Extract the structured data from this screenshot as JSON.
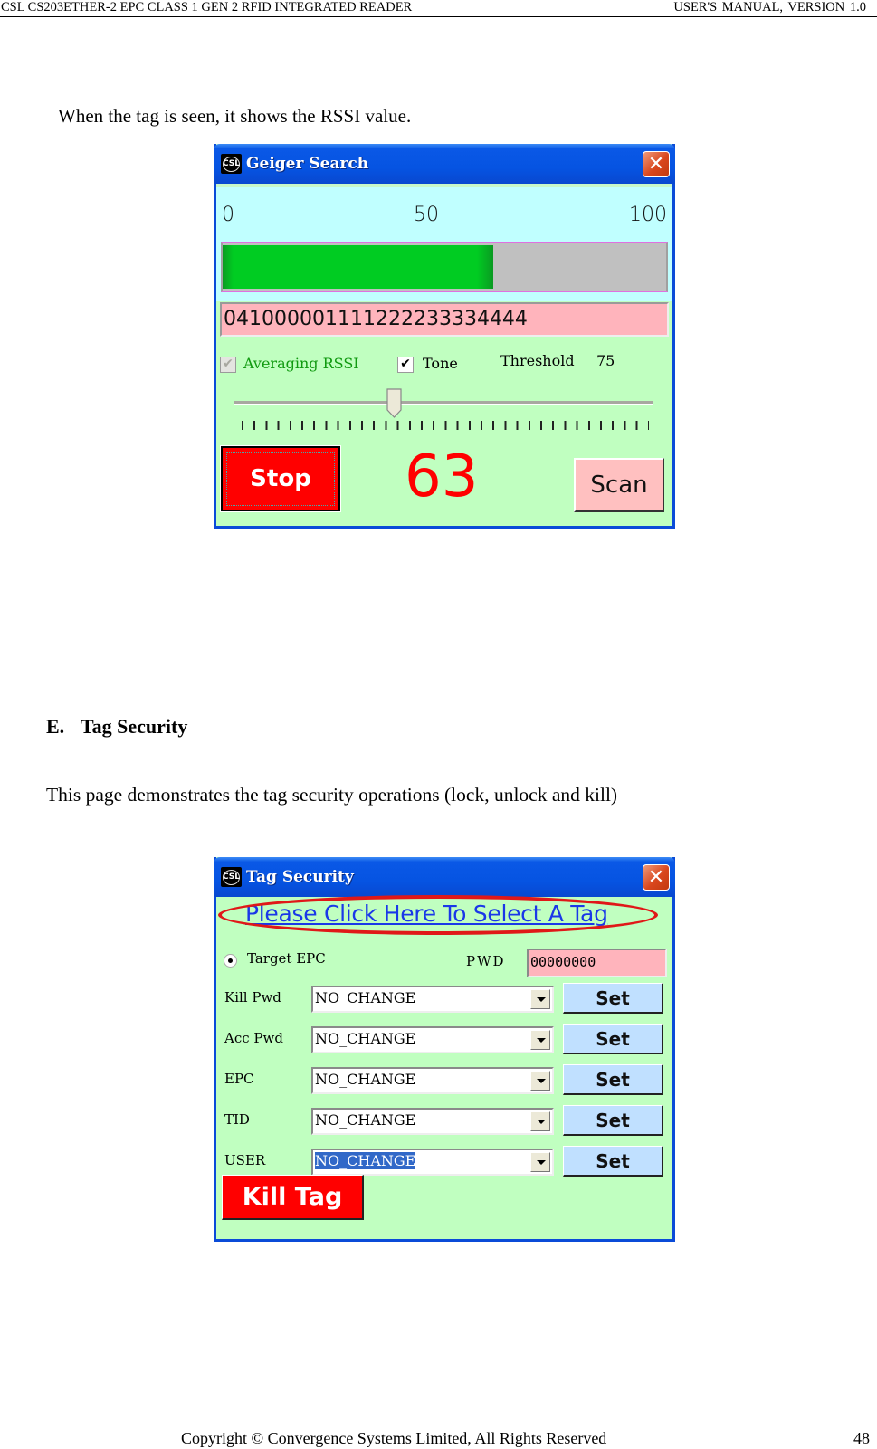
{
  "header": {
    "left": "CSL CS203ETHER-2 EPC CLASS 1 GEN 2 RFID INTEGRATED READER",
    "right": "USER'S  MANUAL,  VERSION  1.0"
  },
  "intro_text": "When the tag is seen, it shows the RSSI value.",
  "geiger_window": {
    "icon_label": "CSL",
    "title": "Geiger Search",
    "close_label": "✕",
    "scale": [
      "0",
      "50",
      "100"
    ],
    "signal_level_percent": 61,
    "epc": "041000001111222233334444",
    "averaging_rssi_label": "Averaging RSSI",
    "averaging_rssi_checked": true,
    "averaging_rssi_enabled": false,
    "tone_label": "Tone",
    "tone_checked": true,
    "check_glyph": "✔",
    "threshold_label": "Threshold",
    "threshold_value": "75",
    "slider_percent": 38,
    "stop_label": "Stop",
    "rssi_value": "63",
    "scan_label": "Scan",
    "colors": {
      "rssi": "#ff0000",
      "bar_fill": "#00cc22",
      "epc_bg": "#ffb4bc"
    }
  },
  "section": {
    "number": "E.",
    "title": "Tag Security",
    "description": "This page demonstrates the tag security operations (lock, unlock and kill)"
  },
  "security_window": {
    "icon_label": "CSL",
    "title": "Tag Security",
    "close_label": "✕",
    "select_link": "Please Click Here To Select A Tag",
    "target_label": "Target EPC",
    "pwd_label": "PWD",
    "pwd_value": "00000000",
    "rows": [
      {
        "label": "Kill Pwd",
        "value": "NO_CHANGE",
        "set": "Set"
      },
      {
        "label": "Acc Pwd",
        "value": "NO_CHANGE",
        "set": "Set"
      },
      {
        "label": "EPC",
        "value": "NO_CHANGE",
        "set": "Set"
      },
      {
        "label": "TID",
        "value": "NO_CHANGE",
        "set": "Set"
      },
      {
        "label": "USER",
        "value": "NO_CHANGE",
        "set": "Set"
      }
    ],
    "kill_label": "Kill Tag"
  },
  "footer": {
    "copyright": "Copyright © Convergence Systems Limited, All Rights Reserved",
    "page_number": "48"
  }
}
